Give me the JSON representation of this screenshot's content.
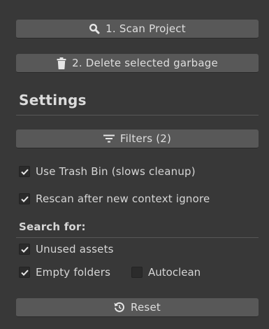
{
  "buttons": {
    "scan_label": "1. Scan Project",
    "delete_label": "2. Delete selected garbage",
    "filters_label": "Filters (2)",
    "reset_label": "Reset"
  },
  "icons": {
    "scan": "search-icon",
    "delete": "trash-icon",
    "filters": "filter-icon",
    "reset": "reset-icon",
    "checked": "check-icon"
  },
  "settings": {
    "title": "Settings",
    "use_trash_bin": {
      "label": "Use Trash Bin (slows cleanup)",
      "checked": true
    },
    "rescan_after_ignore": {
      "label": "Rescan after new context ignore",
      "checked": true
    }
  },
  "search_for": {
    "title": "Search for:",
    "unused_assets": {
      "label": "Unused assets",
      "checked": true
    },
    "empty_folders": {
      "label": "Empty folders",
      "checked": true
    },
    "autoclean": {
      "label": "Autoclean",
      "checked": false
    }
  },
  "colors": {
    "panel_bg": "#383838",
    "button_bg": "#585858",
    "checkbox_bg": "#2b2b2b",
    "text": "#d6d6d6"
  }
}
